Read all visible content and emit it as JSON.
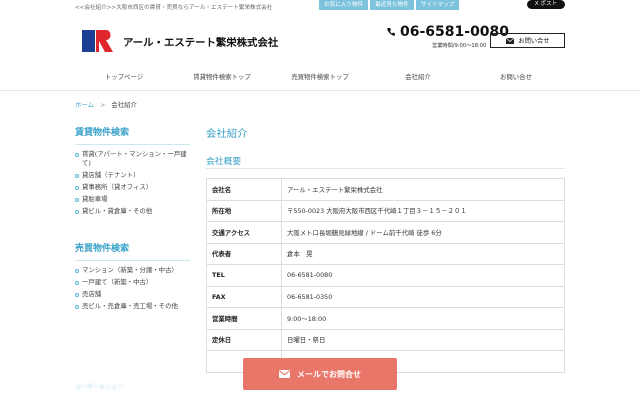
{
  "header": {
    "tagline": "<<会社紹介>>大阪市西区の賃貸・売買ならアール・エステート繁栄株式会社",
    "top_buttons": [
      "お気に入り物件",
      "最近見た物件",
      "サイトマップ"
    ],
    "x_post": "X ポスト",
    "company_name": "アール・エステート繁栄株式会社",
    "phone": "06-6581-0080",
    "hours": "営業時間/9:00〜18:00",
    "contact_label": "お問い合せ",
    "accent_color": "#7ec3dd"
  },
  "nav": {
    "items": [
      "トップページ",
      "賃貸物件検索トップ",
      "売買物件検索トップ",
      "会社紹介",
      "お問い合せ"
    ]
  },
  "breadcrumb": {
    "home": "ホーム",
    "sep": ">",
    "current": "会社紹介"
  },
  "sidebar": {
    "rent": {
      "title": "賃貸物件検索",
      "items": [
        "賃貸(アパート・マンション・一戸建て)",
        "貸店舗（テナント）",
        "貸事務所（貸オフィス）",
        "貸駐車場",
        "貸ビル・貸倉庫・その他"
      ]
    },
    "sale": {
      "title": "売買物件検索",
      "items": [
        "マンション（新築・分譲・中古）",
        "一戸建て（新築・中古）",
        "売店舗",
        "売ビル・売倉庫・売工場・その他"
      ]
    },
    "faded_label": "ユーザーメニュー"
  },
  "main": {
    "title": "会社紹介",
    "section_title": "会社概要",
    "table": [
      {
        "key": "会社名",
        "value": "アール・エステート繁栄株式会社"
      },
      {
        "key": "所在地",
        "value": "〒550-0023 大阪府大阪市西区千代崎１丁目３－１５－２０１"
      },
      {
        "key": "交通アクセス",
        "value": "大阪メトロ長堀鶴見緑地線 / ドーム前千代崎 徒歩 6分"
      },
      {
        "key": "代表者",
        "value": "倉本　晃"
      },
      {
        "key": "TEL",
        "value": "06-6581-0080"
      },
      {
        "key": "FAX",
        "value": "06-6581-0350"
      },
      {
        "key": "営業時間",
        "value": "9:00〜18:00"
      },
      {
        "key": "定休日",
        "value": "日曜日・祭日"
      }
    ]
  },
  "mail_button": {
    "label": "メールでお問合せ",
    "color": "#e8776a"
  }
}
